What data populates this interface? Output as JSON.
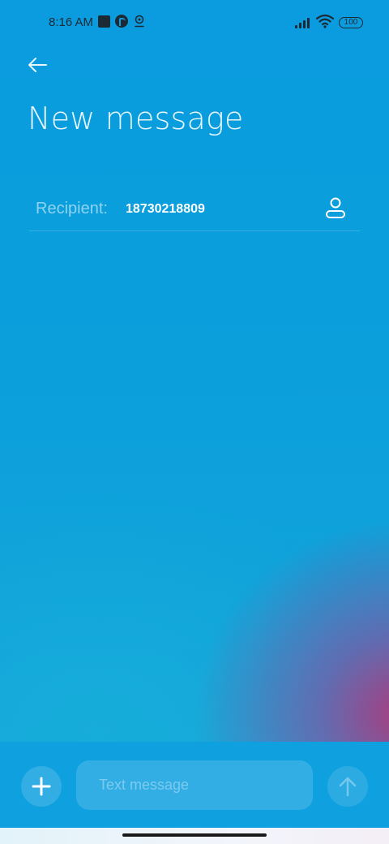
{
  "status_bar": {
    "time": "8:16 AM",
    "battery": "100",
    "icons": [
      "app-square-icon",
      "app-circle-icon",
      "location-pin-icon",
      "signal-icon",
      "wifi-icon",
      "battery-icon"
    ]
  },
  "header": {
    "back_icon": "arrow-left-icon",
    "title": "New message"
  },
  "recipient": {
    "label": "Recipient:",
    "value": "18730218809",
    "contact_icon": "person-icon"
  },
  "composer": {
    "add_icon": "plus-icon",
    "placeholder": "Text message",
    "send_icon": "arrow-up-icon"
  },
  "colors": {
    "background": "#0b9fdc",
    "accent_gradient": "#b23778",
    "title_text": "#e8f6fd",
    "label_text": "#8fd3f0"
  }
}
